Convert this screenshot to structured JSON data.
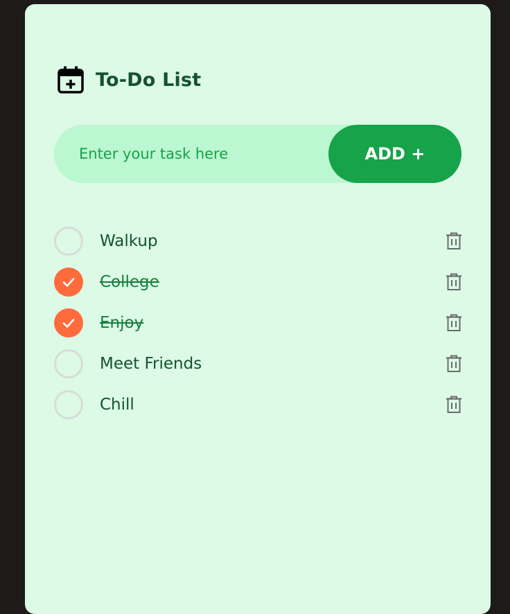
{
  "header": {
    "title": "To-Do List",
    "icon": "calendar-plus-icon"
  },
  "input": {
    "placeholder": "Enter your task here",
    "value": ""
  },
  "add_button": {
    "label": "ADD +"
  },
  "tasks": [
    {
      "text": "Walkup",
      "done": false
    },
    {
      "text": "College",
      "done": true
    },
    {
      "text": "Enjoy",
      "done": true
    },
    {
      "text": "Meet Friends",
      "done": false
    },
    {
      "text": "Chill",
      "done": false
    }
  ],
  "colors": {
    "page_bg": "#1e1a19",
    "card_bg": "#dcfae6",
    "input_bg": "#bbf7d0",
    "accent_green": "#16a34a",
    "title_text": "#14532d",
    "checked_orange": "#ff6b3d",
    "unchecked_ring": "#d8dcd9",
    "trash_icon": "#6b6b6b"
  }
}
